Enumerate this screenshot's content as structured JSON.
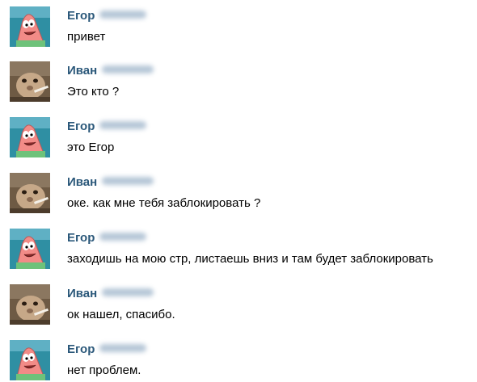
{
  "users": {
    "egor": {
      "name": "Егор",
      "avatar": "patrick-star-avatar"
    },
    "ivan": {
      "name": "Иван",
      "avatar": "hamster-avatar"
    }
  },
  "messages": [
    {
      "author": "Егор",
      "text": "привет"
    },
    {
      "author": "Иван",
      "text": "Это кто ?"
    },
    {
      "author": "Егор",
      "text": "это Егор"
    },
    {
      "author": "Иван",
      "text": "оке. как мне тебя заблокировать ?"
    },
    {
      "author": "Егор",
      "text": "заходишь на мою стр, листаешь вниз и там будет заблокировать"
    },
    {
      "author": "Иван",
      "text": "ок нашел, спасибо."
    },
    {
      "author": "Егор",
      "text": "нет проблем."
    }
  ],
  "colors": {
    "author_name": "#2b587a",
    "message_text": "#000000",
    "background": "#ffffff"
  }
}
